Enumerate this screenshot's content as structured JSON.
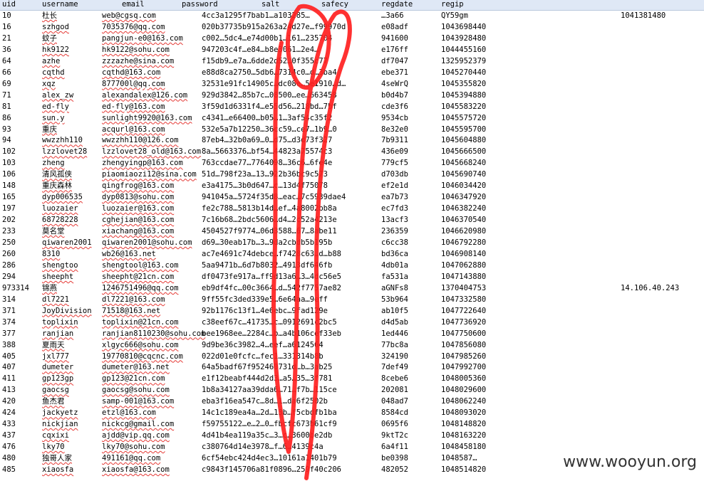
{
  "header": [
    "uid",
    "username",
    "email",
    "password",
    "salt",
    "safecy",
    "regdate",
    "regip"
  ],
  "rows": [
    [
      "10",
      "杜长",
      "web@cgsq.com",
      "4cc3a1295f7bab1…a103285…",
      "…3a66",
      "QY59gm",
      "1041381480",
      ""
    ],
    [
      "16",
      "szhgod",
      "7035376@qq.com",
      "020b37735b915a263a24d27e…f99970d",
      "e08adf",
      "1043698440",
      "",
      ""
    ],
    [
      "21",
      "蚊子",
      "pangjun-e0@163.com",
      "c002…5dc4…e74d00b1…161…235704",
      "941600",
      "1043928480",
      "",
      ""
    ],
    [
      "36",
      "hk9122",
      "hk9122@sohu.com",
      "947203c4f…e84…b8e3061…2e4…",
      "e176ff",
      "1044455160",
      "",
      ""
    ],
    [
      "64",
      "azhe",
      "zzzazhe@sina.com",
      "f15db9…e7a…6dde2d52…0f355c77",
      "df7047",
      "1325952379",
      "",
      ""
    ],
    [
      "66",
      "cqthd",
      "cqthd@163.com",
      "e88d8ca2750…5db6…7314c0…d…3ba4",
      "ebe371",
      "1045270440",
      "",
      ""
    ],
    [
      "69",
      "xqz",
      "877700l@qq.com",
      "32531e91fc14905c…dc08e…5e1910…d…",
      "4seWrQ",
      "1045355820",
      "",
      ""
    ],
    [
      "71",
      "alex_zw",
      "alexandalex@126.com",
      "929d3842…85b7c…08500…ee…663458",
      "b0d4b7",
      "1045394880",
      "",
      ""
    ],
    [
      "81",
      "ed-fly",
      "ed-fly@163.com",
      "3f59d1d6331f4…e55d56…218bd…7bf",
      "cde3f6",
      "1045583220",
      "",
      ""
    ],
    [
      "86",
      "sun.y",
      "sunlight9920@163.com",
      "c4341…e66400…b05…1…3af54c35f2",
      "9534cb",
      "1045575720",
      "",
      ""
    ],
    [
      "93",
      "重庆",
      "acqurl@163.com",
      "532e5a7b12250…36cc59…ce7…1b9…0",
      "8e32e0",
      "1045595700",
      "",
      ""
    ],
    [
      "94",
      "wwzzhh110",
      "wwzzhh110@126.com",
      "87eb4…32b0a69…0…d75…d3d73f327",
      "7b9311",
      "1045604880",
      "",
      ""
    ],
    [
      "102",
      "lzzlovet28",
      "lzzlovet28_old@163.com",
      "8a…5663376…bf54…44823a75574c3",
      "436e09",
      "1045666500",
      "",
      ""
    ],
    [
      "103",
      "zheng",
      "zhengyingp@163.com",
      "763ccdae77…7764098…36c6…6fe4e",
      "779cf5",
      "1045668240",
      "",
      ""
    ],
    [
      "106",
      "清风孤侠",
      "piaomiaozi12@sina.com",
      "51d…798f23a…13…922b36bc9c573",
      "d703db",
      "1045690740",
      "",
      ""
    ],
    [
      "148",
      "重庆森林",
      "qingfrog@163.com",
      "e3a4175…3b0d647…c…13d4f75078",
      "ef2e1d",
      "1046034420",
      "",
      ""
    ],
    [
      "165",
      "dyp006535",
      "dyp0813@sohu.com",
      "941045a…5724f35d8…eac…7c5939dae4",
      "ea7b73",
      "1046347920",
      "",
      ""
    ],
    [
      "197",
      "luozaier",
      "luozaier@163.com",
      "fe2c788…5813b14d…ef…4a8002bb8a",
      "ec7fd3",
      "1046382240",
      "",
      ""
    ],
    [
      "202",
      "68728228",
      "cghejian@163.com",
      "7c16b68…2bdc5606…d4…2c52a4213e",
      "13acf3",
      "1046370540",
      "",
      ""
    ],
    [
      "233",
      "莫名堂",
      "xiachang@163.com",
      "4504527f9774…06d3588…67…8abe11",
      "236359",
      "1046620980",
      "",
      ""
    ],
    [
      "250",
      "qiwaren2001",
      "qiwaren2001@sohu.com",
      "d69…30eab17b…3…9da2cbdb5b195b",
      "c6cc38",
      "1046792280",
      "",
      ""
    ],
    [
      "260",
      "8310",
      "wb26@163.net",
      "ac7e4691c74debce…f7428c63…d…b88",
      "bd36ca",
      "1046908140",
      "",
      ""
    ],
    [
      "286",
      "shengtoo",
      "shengtool@163.com",
      "5aa9471b…6d7b8032…4913df646fb",
      "4db01a",
      "1047062880",
      "",
      ""
    ],
    [
      "294",
      "sheepht",
      "sheepht@21cn.com",
      "df0473fe917a…ff9d13a6…3…4dc56e5",
      "fa531a",
      "1047143880",
      "",
      ""
    ],
    [
      "973314",
      "锦燕",
      "1246751496@qq.com",
      "eb9df4fc…00c3664…d…542f7757ae82",
      "aGNFs8",
      "1370404753",
      "14.106.40.243",
      ""
    ],
    [
      "314",
      "dl7221",
      "dl7221@163.com",
      "9ff55fc3ded339e5…6e64aa…9eff",
      "53b964",
      "1047332580",
      "",
      ""
    ],
    [
      "371",
      "JoyDivision",
      "71518@163.net",
      "92b1176c13f1…4e6ebc…9fad129e",
      "ab10f5",
      "1047722640",
      "",
      ""
    ],
    [
      "374",
      "toplixin",
      "toplixin@21cn.com",
      "c38eef67c…41735…c…0912691c2bc5",
      "d4d5ab",
      "1047736920",
      "",
      ""
    ],
    [
      "377",
      "ranjian",
      "ranjian8110230@sohu.com",
      "bee1968ee…2284c…b…a4b106cef33eb",
      "1ed446",
      "1047750600",
      "",
      ""
    ],
    [
      "388",
      "夏雨天",
      "xlgyc666@sohu.com",
      "9d9be36c3982…4…eef…a6124564",
      "77bc8a",
      "1047856080",
      "",
      ""
    ],
    [
      "405",
      "jxl777",
      "19770810@cqcnc.com",
      "022d01e0fcfc…fec1…331314b8b",
      "324190",
      "1047985260",
      "",
      ""
    ],
    [
      "407",
      "dumeter",
      "dumeter@163.net",
      "64a5badf67f952460731d…b…3ab25",
      "7def49",
      "1047992700",
      "",
      ""
    ],
    [
      "411",
      "gp123gp",
      "gp123@21cn.com",
      "e1f12beabf444d2d3…a5…35…3f781",
      "8cebe6",
      "1048005360",
      "",
      ""
    ],
    [
      "413",
      "gaocsg",
      "gaocsg@sohu.com",
      "1b8a34127aa39dda6…71…f7b…115ce",
      "202081",
      "1048029600",
      "",
      ""
    ],
    [
      "420",
      "鱼杰君",
      "samp-001@163.com",
      "eba3f16ea547c…8d…1…da6f2502b",
      "048ad7",
      "1048062240",
      "",
      ""
    ],
    [
      "424",
      "jackyetz",
      "etzl@163.com",
      "14c1c189ea4a…2d…13b…f5cbdfb1ba",
      "8584cd",
      "1048093020",
      "",
      ""
    ],
    [
      "433",
      "nickjian",
      "nickcg@gmail.com",
      "f59755122…e…2…0…fbcfc673b61cf9",
      "0695f6",
      "1048148820",
      "",
      ""
    ],
    [
      "437",
      "cqxixi",
      "ajdd@vip.qq.com",
      "4d41b4ea119a35c…3…c…3600be2db",
      "9ktT2c",
      "1048163220",
      "",
      ""
    ],
    [
      "476",
      "lky70",
      "lky70@sohu.com",
      "c380764d14e3978…f…6…4139c4a",
      "6a4f11",
      "1048458180",
      "",
      ""
    ],
    [
      "480",
      "独哥人家",
      "491161@qq.com",
      "6cf54ebc424d4ec3…10161a1401b79",
      "be0398",
      "1048587…",
      "",
      ""
    ],
    [
      "485",
      "xiaosfa",
      "xiaosfa@163.com",
      "c9843f145706a81f0896…259f40c206",
      "482052",
      "1048514820",
      "",
      ""
    ]
  ],
  "watermark": "www.wooyun.org",
  "colors": {
    "header_bg": "#dfe8f6",
    "scribble": "#ff2020",
    "spell_underline": "#e53935"
  }
}
